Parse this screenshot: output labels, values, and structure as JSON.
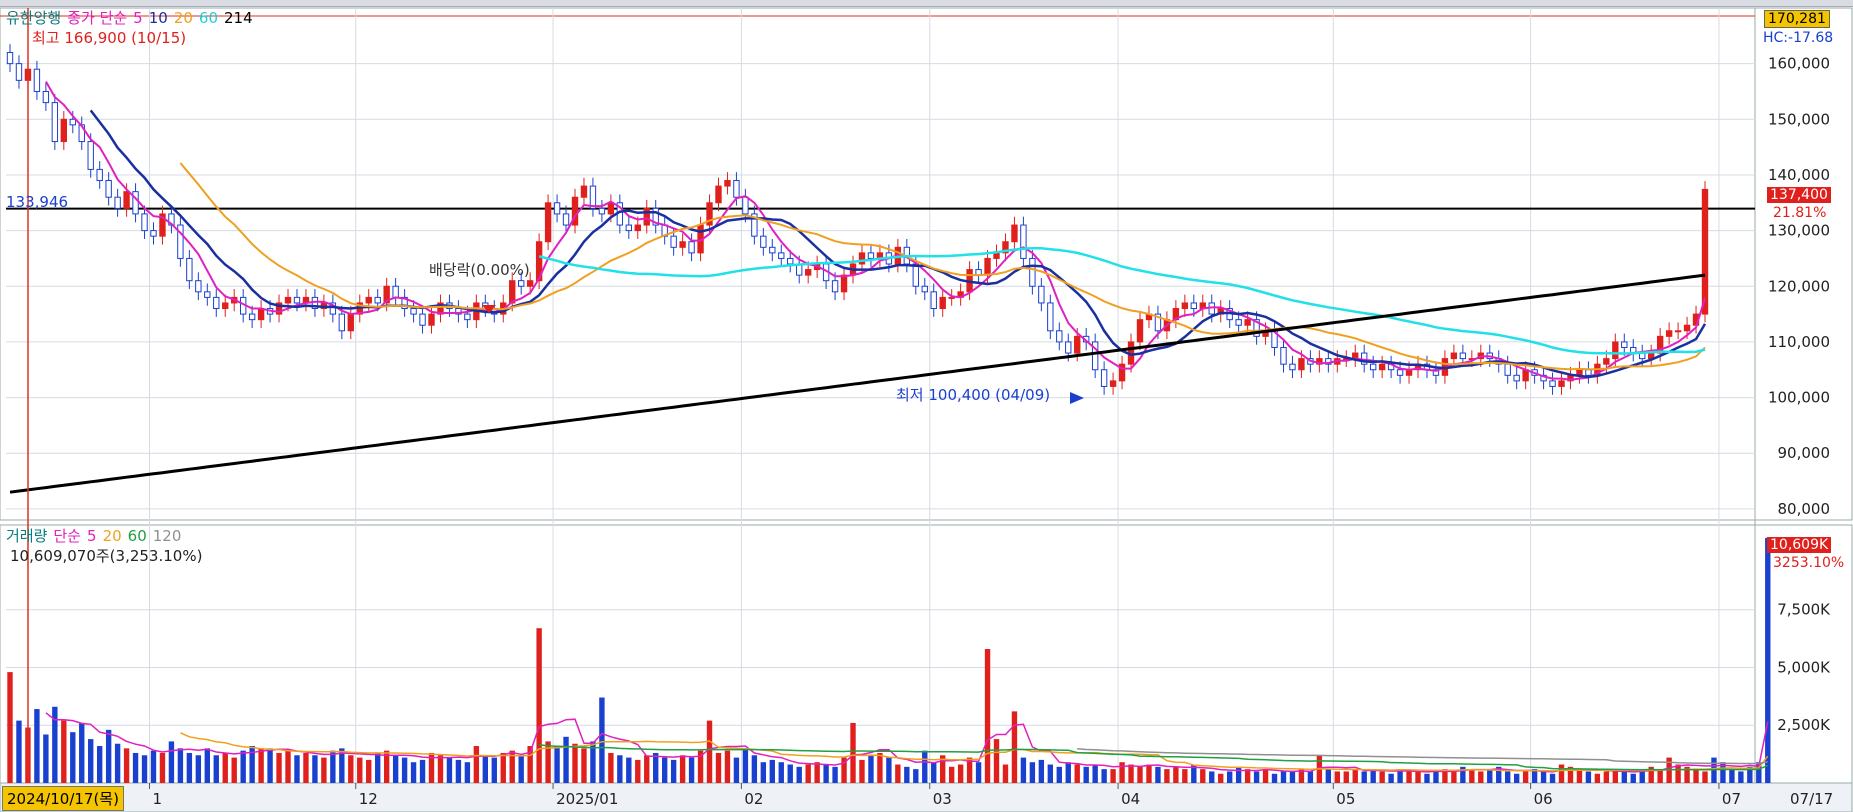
{
  "price_panel": {
    "stock_name": "유한양행",
    "ma_header": {
      "prefix": "종가 단순",
      "periods": [
        "5",
        "10",
        "20",
        "60",
        "214"
      ],
      "colors": [
        "#e020c0",
        "#1a2fa0",
        "#f0a020",
        "#20e0e8",
        "#000000"
      ]
    },
    "high_label": "최고 166,900 (10/15)",
    "low_label": "최저 100,400 (04/09)",
    "dividend_label": "배당락(0.00%)",
    "hline_label": "133,946",
    "top_value_tag": "170,281",
    "top_sub_tag": "HC:-17.68",
    "last_price_tag": "137,400",
    "last_change_tag": "21.81%",
    "y_ticks": [
      "160,000",
      "150,000",
      "140,000",
      "130,000",
      "120,000",
      "110,000",
      "100,000",
      "90,000",
      "80,000"
    ]
  },
  "volume_panel": {
    "title": "거래량",
    "ma_header": {
      "prefix": "단순",
      "periods": [
        "5",
        "20",
        "60",
        "120"
      ],
      "colors": [
        "#e020c0",
        "#f0a020",
        "#20a040",
        "#909090"
      ]
    },
    "current_volume_label": "10,609,070주(3,253.10%)",
    "last_volume_tag": "10,609K",
    "last_volume_pct_tag": "3253.10%",
    "y_ticks": [
      "7,500K",
      "5,000K",
      "2,500K"
    ]
  },
  "x_axis": {
    "ticks": [
      "1",
      "12",
      "2025/01",
      "02",
      "03",
      "04",
      "05",
      "06",
      "07"
    ],
    "cursor_date": "2024/10/17(목)",
    "end_label": "07/17"
  },
  "colors": {
    "up": "#e0201c",
    "down": "#1a40d0",
    "hline": "#000000",
    "cursor": "#e03020"
  },
  "chart_data": {
    "type": "candlestick",
    "title": "유한양행",
    "x_range": [
      "2024-10-15",
      "2025-07-17"
    ],
    "price_ylim": [
      78000,
      170000
    ],
    "volume_ylim": [
      0,
      10609
    ],
    "volume_unit": "K",
    "annotations": {
      "high": {
        "date": "2024-10-15",
        "value": 166900
      },
      "low": {
        "date": "2025-04-09",
        "value": 100400
      },
      "horizontal_line": 133946,
      "last_close": 137400,
      "last_volume_k": 10609
    },
    "close": [
      160000,
      157000,
      159000,
      155000,
      153000,
      146000,
      150000,
      149000,
      146000,
      141000,
      139000,
      136000,
      134000,
      137000,
      133000,
      130000,
      129000,
      133000,
      131000,
      125000,
      121000,
      119000,
      118000,
      116000,
      117000,
      118000,
      115000,
      114000,
      116000,
      115000,
      117000,
      118000,
      117000,
      118000,
      116000,
      117000,
      115000,
      112000,
      115000,
      117000,
      118000,
      117000,
      120000,
      118000,
      116000,
      115000,
      113000,
      115000,
      117000,
      116000,
      115000,
      114000,
      117000,
      116000,
      115000,
      117000,
      121000,
      120000,
      121000,
      128000,
      135000,
      133000,
      131000,
      136000,
      138000,
      134000,
      133000,
      135000,
      131000,
      130000,
      131000,
      134000,
      131000,
      129000,
      127000,
      128000,
      126000,
      131000,
      135000,
      138000,
      139000,
      136000,
      133000,
      129000,
      127000,
      126000,
      125000,
      124000,
      122000,
      123000,
      124000,
      121000,
      119000,
      122000,
      124000,
      126000,
      125000,
      126000,
      124000,
      127000,
      124000,
      120000,
      119000,
      116000,
      118000,
      118000,
      119000,
      123000,
      122000,
      125000,
      126000,
      128000,
      131000,
      125000,
      120000,
      117000,
      112000,
      110000,
      108000,
      111000,
      110000,
      105000,
      102000,
      103000,
      106000,
      110000,
      114000,
      115000,
      112000,
      114000,
      116000,
      117000,
      116000,
      117000,
      115000,
      116000,
      114000,
      113000,
      114000,
      111000,
      112000,
      109000,
      106000,
      105000,
      107000,
      106000,
      107000,
      106000,
      107000,
      107000,
      108000,
      106000,
      105000,
      106000,
      105000,
      104000,
      105000,
      106000,
      105000,
      104000,
      107000,
      108000,
      107000,
      107000,
      108000,
      107000,
      106000,
      104000,
      103000,
      105000,
      104000,
      103000,
      102000,
      103000,
      104000,
      105000,
      104000,
      106000,
      107000,
      110000,
      109000,
      108000,
      107000,
      108000,
      111000,
      112000,
      112000,
      113000,
      115000,
      137400
    ],
    "volume_k": [
      4800,
      2700,
      2400,
      3200,
      2100,
      3300,
      2700,
      2200,
      2600,
      1900,
      1600,
      2300,
      1700,
      1500,
      1300,
      1200,
      1400,
      1300,
      1800,
      1500,
      1300,
      1200,
      1500,
      1200,
      1300,
      1100,
      1400,
      1600,
      1500,
      1500,
      1300,
      1400,
      1200,
      1300,
      1200,
      1100,
      1400,
      1500,
      1200,
      1100,
      1000,
      1300,
      1400,
      1200,
      1100,
      900,
      1000,
      1300,
      1200,
      1100,
      1000,
      900,
      1600,
      1200,
      1100,
      1300,
      1400,
      1200,
      1600,
      6700,
      1800,
      1600,
      2000,
      1700,
      1500,
      1800,
      3700,
      1300,
      1200,
      1100,
      1000,
      1200,
      1300,
      1100,
      1000,
      1200,
      1100,
      1400,
      2700,
      1300,
      1400,
      1100,
      1500,
      1200,
      900,
      1000,
      900,
      800,
      700,
      800,
      900,
      800,
      700,
      1100,
      2600,
      1000,
      1200,
      1300,
      1100,
      800,
      700,
      600,
      1400,
      900,
      1200,
      700,
      800,
      1100,
      900,
      5800,
      1900,
      800,
      3100,
      1100,
      900,
      1000,
      800,
      700,
      900,
      800,
      700,
      800,
      600,
      600,
      900,
      800,
      700,
      800,
      700,
      600,
      700,
      600,
      800,
      600,
      500,
      400,
      500,
      700,
      600,
      500,
      600,
      400,
      500,
      500,
      600,
      500,
      1200,
      600,
      500,
      500,
      600,
      500,
      600,
      500,
      400,
      600,
      500,
      500,
      400,
      500,
      600,
      500,
      700,
      600,
      500,
      600,
      700,
      500,
      400,
      500,
      600,
      500,
      400,
      800,
      700,
      600,
      500,
      400,
      500,
      600,
      500,
      400,
      500,
      700,
      600,
      1100,
      800,
      700,
      600,
      500,
      1100,
      900,
      600,
      500,
      700,
      900,
      10609
    ]
  }
}
